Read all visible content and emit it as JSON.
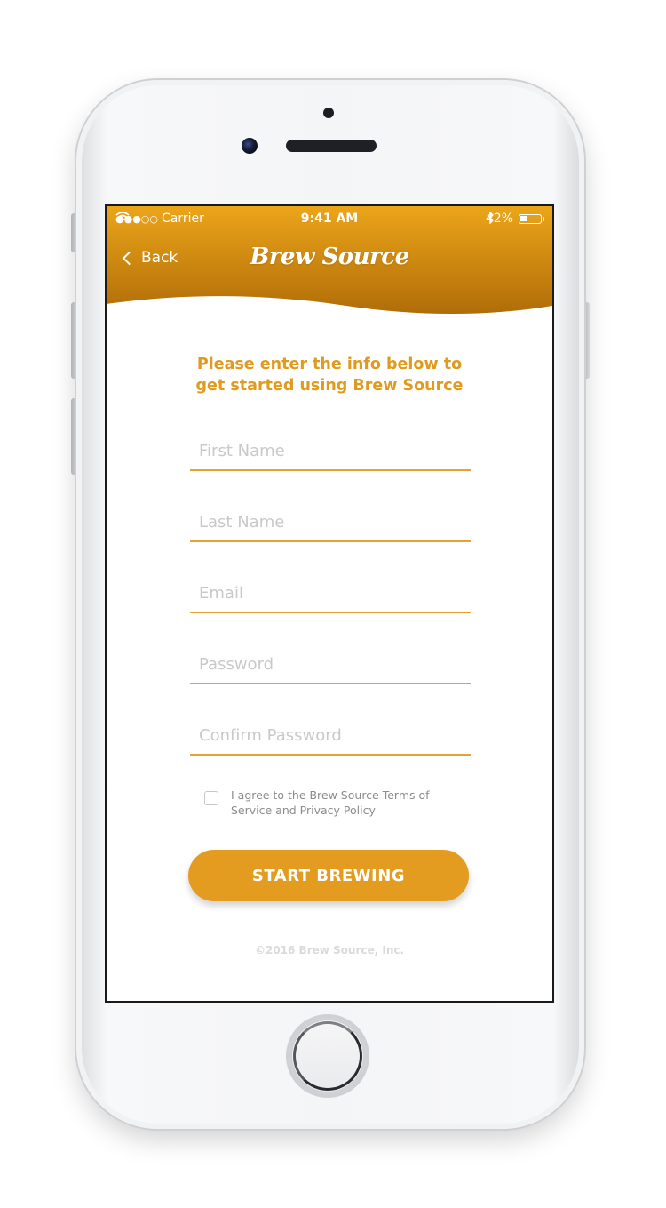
{
  "status_bar": {
    "signal_dots": "●●●○○",
    "carrier": "Carrier",
    "time": "9:41 AM",
    "battery_percent": "42%",
    "battery_level": 0.42
  },
  "nav": {
    "back_label": "Back",
    "brand": "Brew Source"
  },
  "form": {
    "intro_line1": "Please enter the info below to",
    "intro_line2": "get started using Brew Source",
    "fields": {
      "first_name": {
        "placeholder": "First Name",
        "value": ""
      },
      "last_name": {
        "placeholder": "Last Name",
        "value": ""
      },
      "email": {
        "placeholder": "Email",
        "value": ""
      },
      "password": {
        "placeholder": "Password",
        "value": ""
      },
      "confirm_password": {
        "placeholder": "Confirm Password",
        "value": ""
      }
    },
    "agree_line1": "I agree to the Brew Source Terms of",
    "agree_line2": "Service and Privacy Policy",
    "agree_checked": false,
    "submit_label": "START BREWING"
  },
  "footer": {
    "copyright": "©2016 Brew Source, Inc."
  },
  "colors": {
    "accent": "#e39c1f",
    "header_top": "#e9a51c",
    "header_bottom": "#b5710a"
  },
  "icons": [
    "chevron-left-icon",
    "wifi-icon",
    "bluetooth-icon",
    "battery-icon"
  ]
}
